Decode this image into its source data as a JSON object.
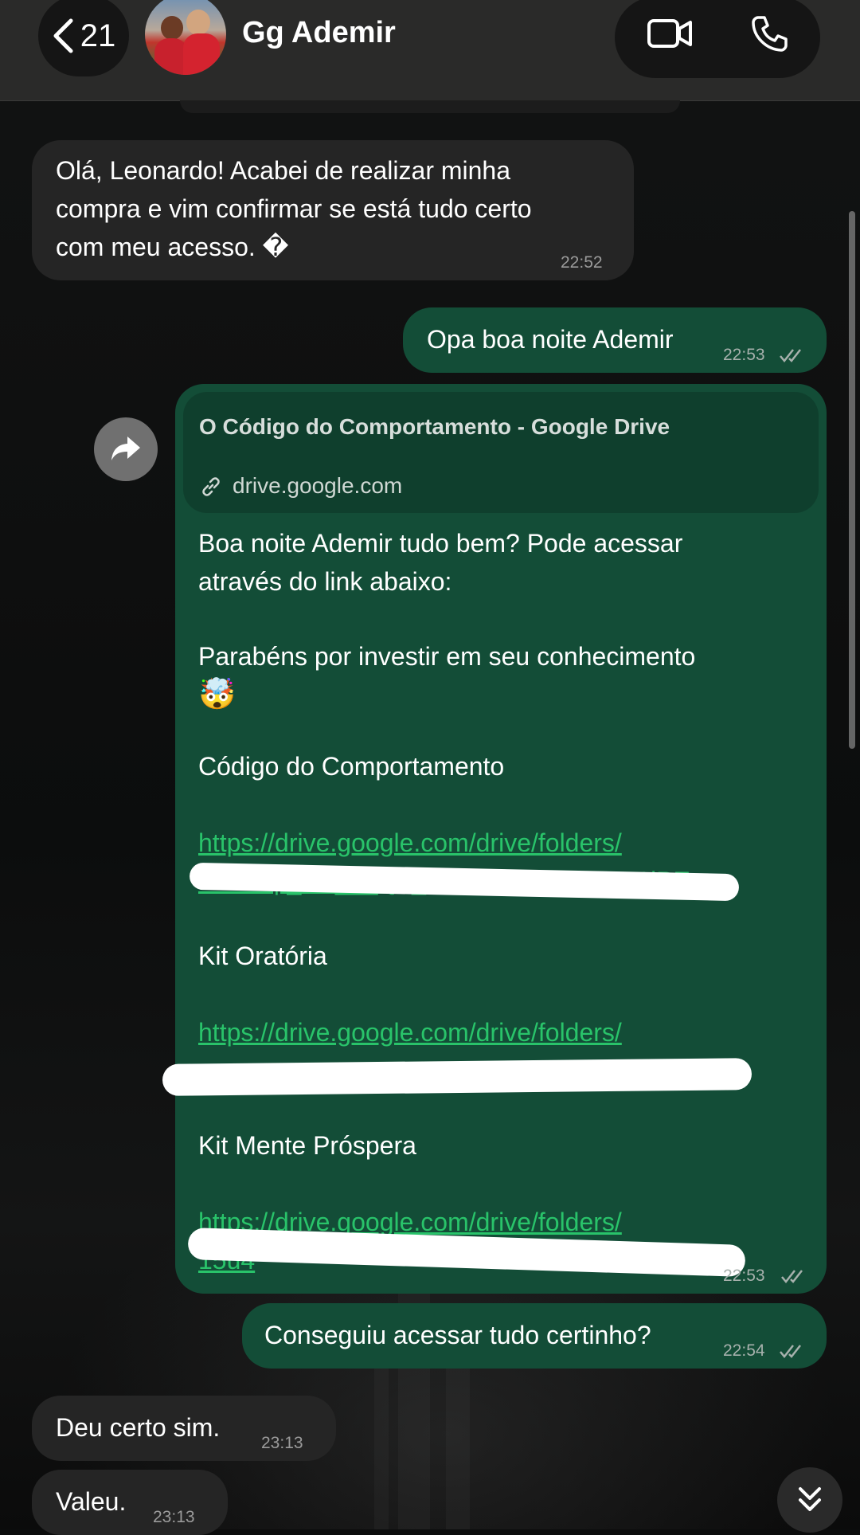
{
  "header": {
    "back_count": "21",
    "contact_name": "Gg Ademir"
  },
  "messages": {
    "m1": {
      "text": "Olá, Leonardo! Acabei de realizar minha\ncompra e vim confirmar se está tudo certo\ncom meu acesso. �",
      "time": "22:52"
    },
    "m2": {
      "text": "Opa boa noite Ademir",
      "time": "22:53"
    },
    "m3": {
      "link_title": "O Código do Comportamento  - Google Drive",
      "link_domain": "drive.google.com",
      "line1": "Boa noite Ademir tudo bem? Pode acessar",
      "line2": "através do link abaixo:",
      "line3": "Parabéns por investir em seu conhecimento",
      "emoji": "🤯",
      "section1": "Código do Comportamento",
      "url1": "https://drive.google.com/drive/folders/",
      "url1_tail": "1o8Ca| _O7___Q1_lhcmF Ygb kR14ro1iPE",
      "section2": "Kit Oratória",
      "url2": "https://drive.google.com/drive/folders/",
      "section3": "Kit Mente Próspera",
      "url3": "https://drive.google.com/drive/folders/",
      "url3_tail": "15u4",
      "time": "22:53"
    },
    "m4": {
      "text": "Conseguiu acessar tudo certinho?",
      "time": "22:54"
    },
    "m5": {
      "text": "Deu certo sim.",
      "time": "23:13"
    },
    "m6": {
      "text": "Valeu.",
      "time": "23:13"
    }
  },
  "colors": {
    "outgoing_bubble": "#134d37",
    "incoming_bubble": "#252525",
    "link": "#29c36a",
    "header": "#2a2a29"
  },
  "icons": [
    "back-chevron-icon",
    "video-call-icon",
    "phone-icon",
    "forward-icon",
    "link-icon",
    "double-check-icon",
    "double-chevron-down-icon"
  ]
}
